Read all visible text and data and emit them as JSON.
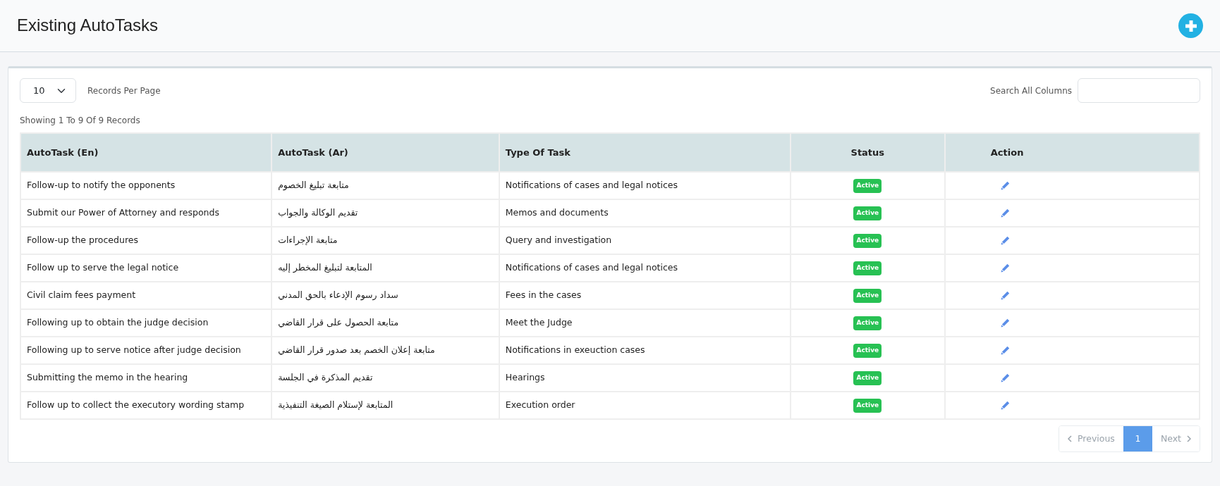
{
  "header": {
    "title": "Existing AutoTasks"
  },
  "controls": {
    "page_size": "10",
    "page_size_label": "Records Per Page",
    "search_label": "Search All Columns"
  },
  "summary": "Showing 1 To 9 Of 9 Records",
  "table": {
    "columns": [
      "AutoTask (En)",
      "AutoTask (Ar)",
      "Type Of Task",
      "Status",
      "Action"
    ],
    "rows": [
      {
        "en": "Follow-up to notify the opponents",
        "ar": "متابعة تبليغ الخصوم",
        "type": "Notifications of cases and legal notices",
        "status": "Active"
      },
      {
        "en": "Submit our Power of Attorney and responds",
        "ar": "تقديم الوكالة والجواب",
        "type": "Memos and documents",
        "status": "Active"
      },
      {
        "en": "Follow-up the procedures",
        "ar": "متابعة الإجراءات",
        "type": "Query and investigation",
        "status": "Active"
      },
      {
        "en": "Follow up to serve the legal notice",
        "ar": "المتابعة لتبليغ المخطر إليه",
        "type": "Notifications of cases and legal notices",
        "status": "Active"
      },
      {
        "en": "Civil claim fees payment",
        "ar": "سداد رسوم الإدعاء بالحق المدني",
        "type": "Fees in the cases",
        "status": "Active"
      },
      {
        "en": "Following up to obtain the judge decision",
        "ar": "متابعة الحصول على قرار القاضي",
        "type": "Meet the Judge",
        "status": "Active"
      },
      {
        "en": "Following up to serve notice after judge decision",
        "ar": "متابعة إعلان الخصم بعد صدور قرار القاضي",
        "type": "Notifications in exeuction cases",
        "status": "Active"
      },
      {
        "en": "Submitting the memo in the hearing",
        "ar": "تقديم المذكرة في الجلسة",
        "type": "Hearings",
        "status": "Active"
      },
      {
        "en": "Follow up to collect the executory wording stamp",
        "ar": "المتابعة لإستلام الصيغة التنفيذية",
        "type": "Execution order",
        "status": "Active"
      }
    ]
  },
  "pagination": {
    "previous": {
      "label": "Previous",
      "disabled": true
    },
    "pages": [
      {
        "label": "1",
        "selected": true
      }
    ],
    "next": {
      "label": "Next",
      "disabled": true
    }
  }
}
